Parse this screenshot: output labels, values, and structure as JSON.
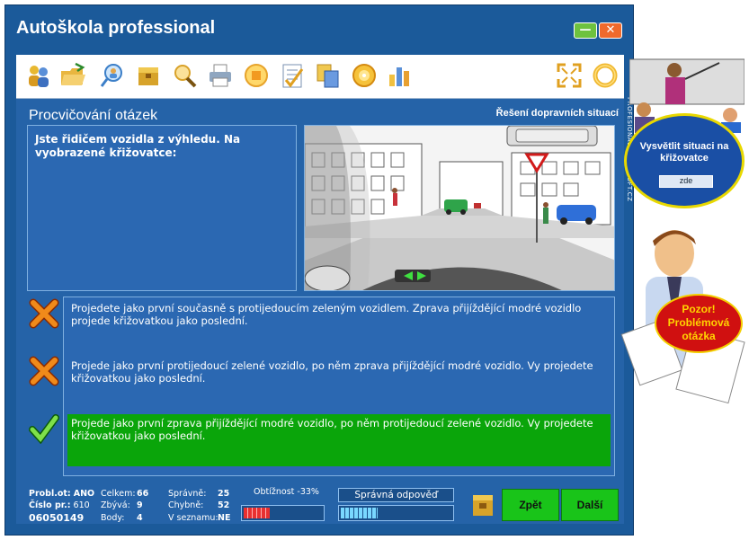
{
  "window": {
    "title": "Autoškola professional",
    "minimize_symbol": "—",
    "close_symbol": "✕"
  },
  "toolbar": {
    "icons": [
      "users-icon",
      "folder-open-icon",
      "search-person-icon",
      "box-icon",
      "magnify-icon",
      "print-icon",
      "stop-icon",
      "checklist-icon",
      "copy-icon",
      "disc-icon",
      "chart-icon"
    ],
    "right_icons": [
      "fullscreen-icon",
      "ring-icon"
    ]
  },
  "section": {
    "title": "Procvičování otázek",
    "subtitle": "Řešení dopravních situací"
  },
  "question": {
    "text": "Jste řidičem vozidla z výhledu. Na vyobrazené křižovatce:"
  },
  "answers": [
    {
      "text": "Projedete jako první současně s protijedoucím zeleným vozidlem. Zprava přijíždějící modré vozidlo projede křižovatkou jako poslední.",
      "status": "wrong"
    },
    {
      "text": "Projede jako první protijedoucí zelené vozidlo, po něm zprava přijíždějící modré vozidlo. Vy projedete křižovatkou jako poslední.",
      "status": "wrong"
    },
    {
      "text": "Projede jako první zprava přijíždějící modré vozidlo, po něm protijedoucí zelené vozidlo. Vy projedete křižovatkou jako poslední.",
      "status": "correct"
    }
  ],
  "stats": {
    "problot_label": "Probl.ot:",
    "problot_value": "ANO",
    "cislo_label": "Číslo pr.:",
    "cislo_value": "610",
    "code": "06050149",
    "celkem_label": "Celkem:",
    "celkem_value": "66",
    "zbyva_label": "Zbývá:",
    "zbyva_value": "9",
    "body_label": "Body:",
    "body_value": "4",
    "spravne_label": "Správně:",
    "spravne_value": "25",
    "chybne_label": "Chybně:",
    "chybne_value": "52",
    "seznamu_label": "V seznamu:",
    "seznamu_value": "NE",
    "obtiznost_label": "Obtížnost -33%",
    "obtiznost_fraction": 0.33,
    "spravna_label": "Správná odpověď",
    "spravna_fraction": 0.33
  },
  "buttons": {
    "back": "Zpět",
    "next": "Další"
  },
  "side": {
    "vertical_text": "PROFESIONAL ZSOBESOFT.CZ",
    "bubble_text": "Vysvětlit situaci na křižovatce",
    "bubble_button": "zde",
    "warning_text": "Pozor! Problémová otázka"
  },
  "colors": {
    "window_blue": "#1b5a9a",
    "panel_blue": "#2b68b2",
    "correct_green": "#0aa50a",
    "button_green": "#19c419",
    "warning_red": "#d01010"
  }
}
